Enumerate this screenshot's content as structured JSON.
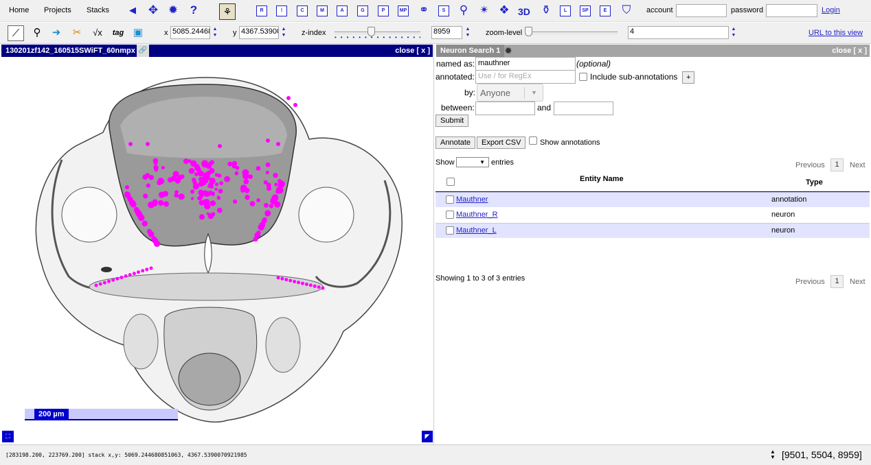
{
  "menubar": {
    "home": "Home",
    "projects": "Projects",
    "stacks": "Stacks",
    "tool_icons": [
      {
        "name": "navigate-back-icon",
        "glyph": "◀"
      },
      {
        "name": "move-icon",
        "glyph": "✥"
      },
      {
        "name": "settings-gear-icon",
        "glyph": "✹"
      },
      {
        "name": "help-icon",
        "glyph": "?"
      }
    ],
    "widget_boxes": [
      "R",
      "!",
      "C",
      "M",
      "A",
      "G",
      "P",
      "MP",
      "",
      "S",
      "",
      "",
      "",
      "3D",
      "",
      "L",
      "SP",
      "E"
    ],
    "account_label": "account",
    "password_label": "password",
    "login_link": "Login",
    "account_value": "",
    "password_value": ""
  },
  "toolbar": {
    "x_label": "x",
    "x_value": "5085.24468",
    "y_label": "y",
    "y_value": "4367.53900",
    "z_label": "z-index",
    "z_value": "8959",
    "z_slider_fraction": 0.42,
    "zoom_label": "zoom-level",
    "zoom_value": "4",
    "zoom_slider_fraction": 0.0,
    "url_link": "URL to this view"
  },
  "stack": {
    "title": "130201zf142_160515SWiFT_60nmpx",
    "close": "close [ x ]",
    "scale_label": "200 µm"
  },
  "search": {
    "tab_title": "Neuron Search 1",
    "close": "close [ x ]",
    "named_as_label": "named as:",
    "named_as_value": "mauthner",
    "optional": "(optional)",
    "annotated_label": "annotated:",
    "annotated_placeholder": "Use / for RegEx",
    "include_sub": "Include sub-annotations",
    "plus": "+",
    "by_label": "by:",
    "by_value": "Anyone",
    "between_label": "between:",
    "and_label": "and",
    "submit": "Submit",
    "annotate_btn": "Annotate",
    "export_btn": "Export CSV",
    "show_annotations": "Show annotations",
    "show_label": "Show",
    "entries_label": "entries",
    "previous": "Previous",
    "page": "1",
    "next": "Next",
    "col_entity": "Entity Name",
    "col_type": "Type",
    "rows": [
      {
        "entity": "Mauthner",
        "type": "annotation"
      },
      {
        "entity": "Mauthner_R",
        "type": "neuron"
      },
      {
        "entity": "Mauthner_L",
        "type": "neuron"
      }
    ],
    "showing": "Showing 1 to 3 of 3 entries"
  },
  "status": {
    "text": "[283198.200, 223769.200] stack x,y: 5069.244680851063, 4367.5390070921985",
    "coords": "[9501, 5504, 8959]"
  },
  "colors": {
    "accent": "#1f22c8",
    "title_bar": "#000080",
    "marker": "#ff00ff",
    "row_highlight": "#e2e4ff"
  }
}
